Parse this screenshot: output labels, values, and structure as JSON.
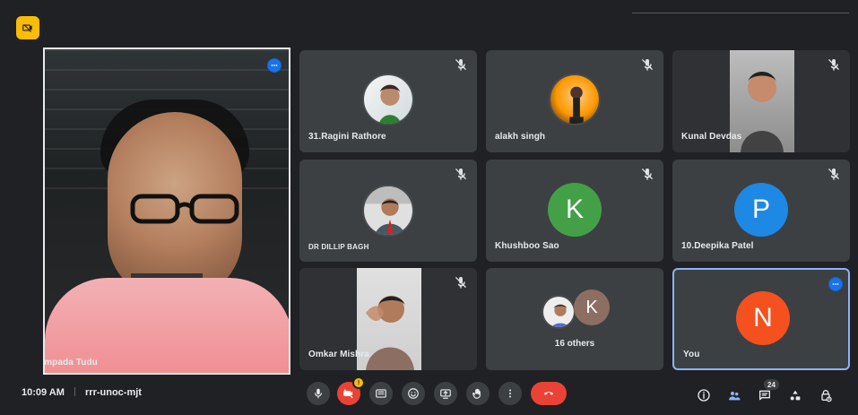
{
  "ui": {
    "top_badge_icon": "meet-host-controls-icon",
    "accent_blue": "#1a73e8",
    "accent_yellow": "#fbbc04",
    "end_call_red": "#ea4335"
  },
  "main_speaker": {
    "name": "Dr Rampada Tudu",
    "more_icon": "more-options-icon"
  },
  "tiles": [
    {
      "name": "31.Ragini Rathore",
      "muted": true,
      "mic_icon": "mic-off-icon",
      "avatar": "photo"
    },
    {
      "name": "alakh singh",
      "muted": true,
      "mic_icon": "mic-off-icon",
      "avatar": "photo"
    },
    {
      "name": "Kunal Devdas",
      "muted": true,
      "mic_icon": "mic-off-icon",
      "avatar": "video"
    },
    {
      "name": "DR DILLIP BAGH",
      "muted": true,
      "mic_icon": "mic-off-icon",
      "avatar": "photo"
    },
    {
      "name": "Khushboo Sao",
      "muted": true,
      "mic_icon": "mic-off-icon",
      "avatar_letter": "K",
      "avatar_color": "#43a047"
    },
    {
      "name": "10.Deepika Patel",
      "muted": true,
      "mic_icon": "mic-off-icon",
      "avatar_letter": "P",
      "avatar_color": "#1e88e5"
    },
    {
      "name": "Omkar Mishra",
      "muted": true,
      "mic_icon": "mic-off-icon",
      "avatar": "video"
    },
    {
      "name": "16 others",
      "muted": false,
      "avatar_letter": "K",
      "avatar_color": "#8d6e63"
    },
    {
      "name": "You",
      "muted": false,
      "more_icon": "more-options-icon",
      "avatar_letter": "N",
      "avatar_color": "#f4511e"
    }
  ],
  "bottom_bar": {
    "time": "10:09 AM",
    "meeting_code": "rrr-unoc-mjt",
    "controls": [
      {
        "icon": "mic-icon"
      },
      {
        "icon": "camera-off-icon",
        "badge": "!"
      },
      {
        "icon": "captions-icon"
      },
      {
        "icon": "emoji-icon"
      },
      {
        "icon": "present-screen-icon"
      },
      {
        "icon": "raise-hand-icon"
      },
      {
        "icon": "more-vert-icon"
      },
      {
        "icon": "end-call-icon"
      }
    ],
    "right": {
      "info_icon": "info-icon",
      "people_icon": "people-icon",
      "people_count": "24",
      "chat_icon": "chat-icon",
      "activities_icon": "activities-icon",
      "lock_icon": "host-lock-icon"
    }
  }
}
